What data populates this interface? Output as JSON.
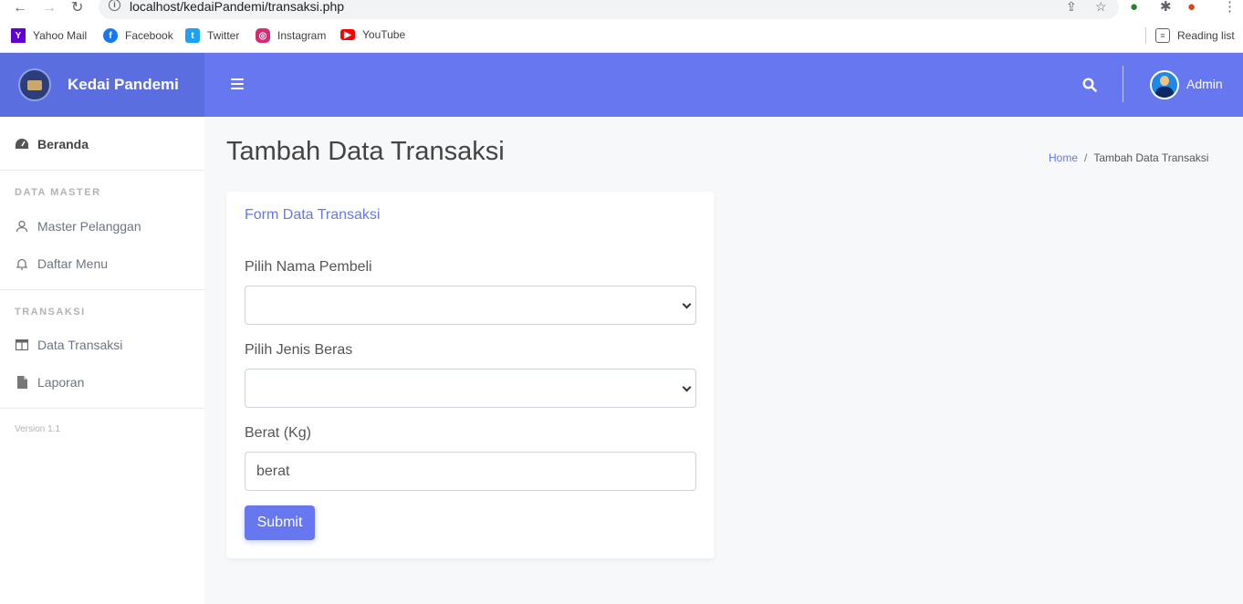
{
  "browser": {
    "url": "localhost/kedaiPandemi/transaksi.php",
    "bookmarks": [
      {
        "label": "Yahoo Mail",
        "icon": "yahoo-icon",
        "color": "#5f01d1",
        "glyph": "Y"
      },
      {
        "label": "Facebook",
        "icon": "facebook-icon",
        "color": "#1877f2",
        "glyph": "f"
      },
      {
        "label": "Twitter",
        "icon": "twitter-icon",
        "color": "#1da1f2",
        "glyph": "t"
      },
      {
        "label": "Instagram",
        "icon": "instagram-icon",
        "color": "#d62976",
        "glyph": "◎"
      },
      {
        "label": "YouTube",
        "icon": "youtube-icon",
        "color": "#ff0000",
        "glyph": "▶"
      }
    ],
    "reading_list": "Reading list"
  },
  "brand": {
    "name": "Kedai Pandemi"
  },
  "topbar": {
    "user": "Admin",
    "accent": "#6777ef"
  },
  "sidebar": {
    "dashboard": "Beranda",
    "section_master": "DATA MASTER",
    "items_master": [
      "Master Pelanggan",
      "Daftar Menu"
    ],
    "section_transaksi": "TRANSAKSI",
    "items_transaksi": [
      "Data Transaksi",
      "Laporan"
    ],
    "version": "Version 1.1"
  },
  "page": {
    "title": "Tambah Data Transaksi",
    "breadcrumb_home": "Home",
    "breadcrumb_sep": "/",
    "breadcrumb_current": "Tambah Data Transaksi"
  },
  "form": {
    "title": "Form Data Transaksi",
    "buyer_label": "Pilih Nama Pembeli",
    "buyer_value": "",
    "rice_label": "Pilih Jenis Beras",
    "rice_value": "",
    "weight_label": "Berat (Kg)",
    "weight_placeholder": "berat",
    "weight_value": "",
    "submit_label": "Submit"
  }
}
